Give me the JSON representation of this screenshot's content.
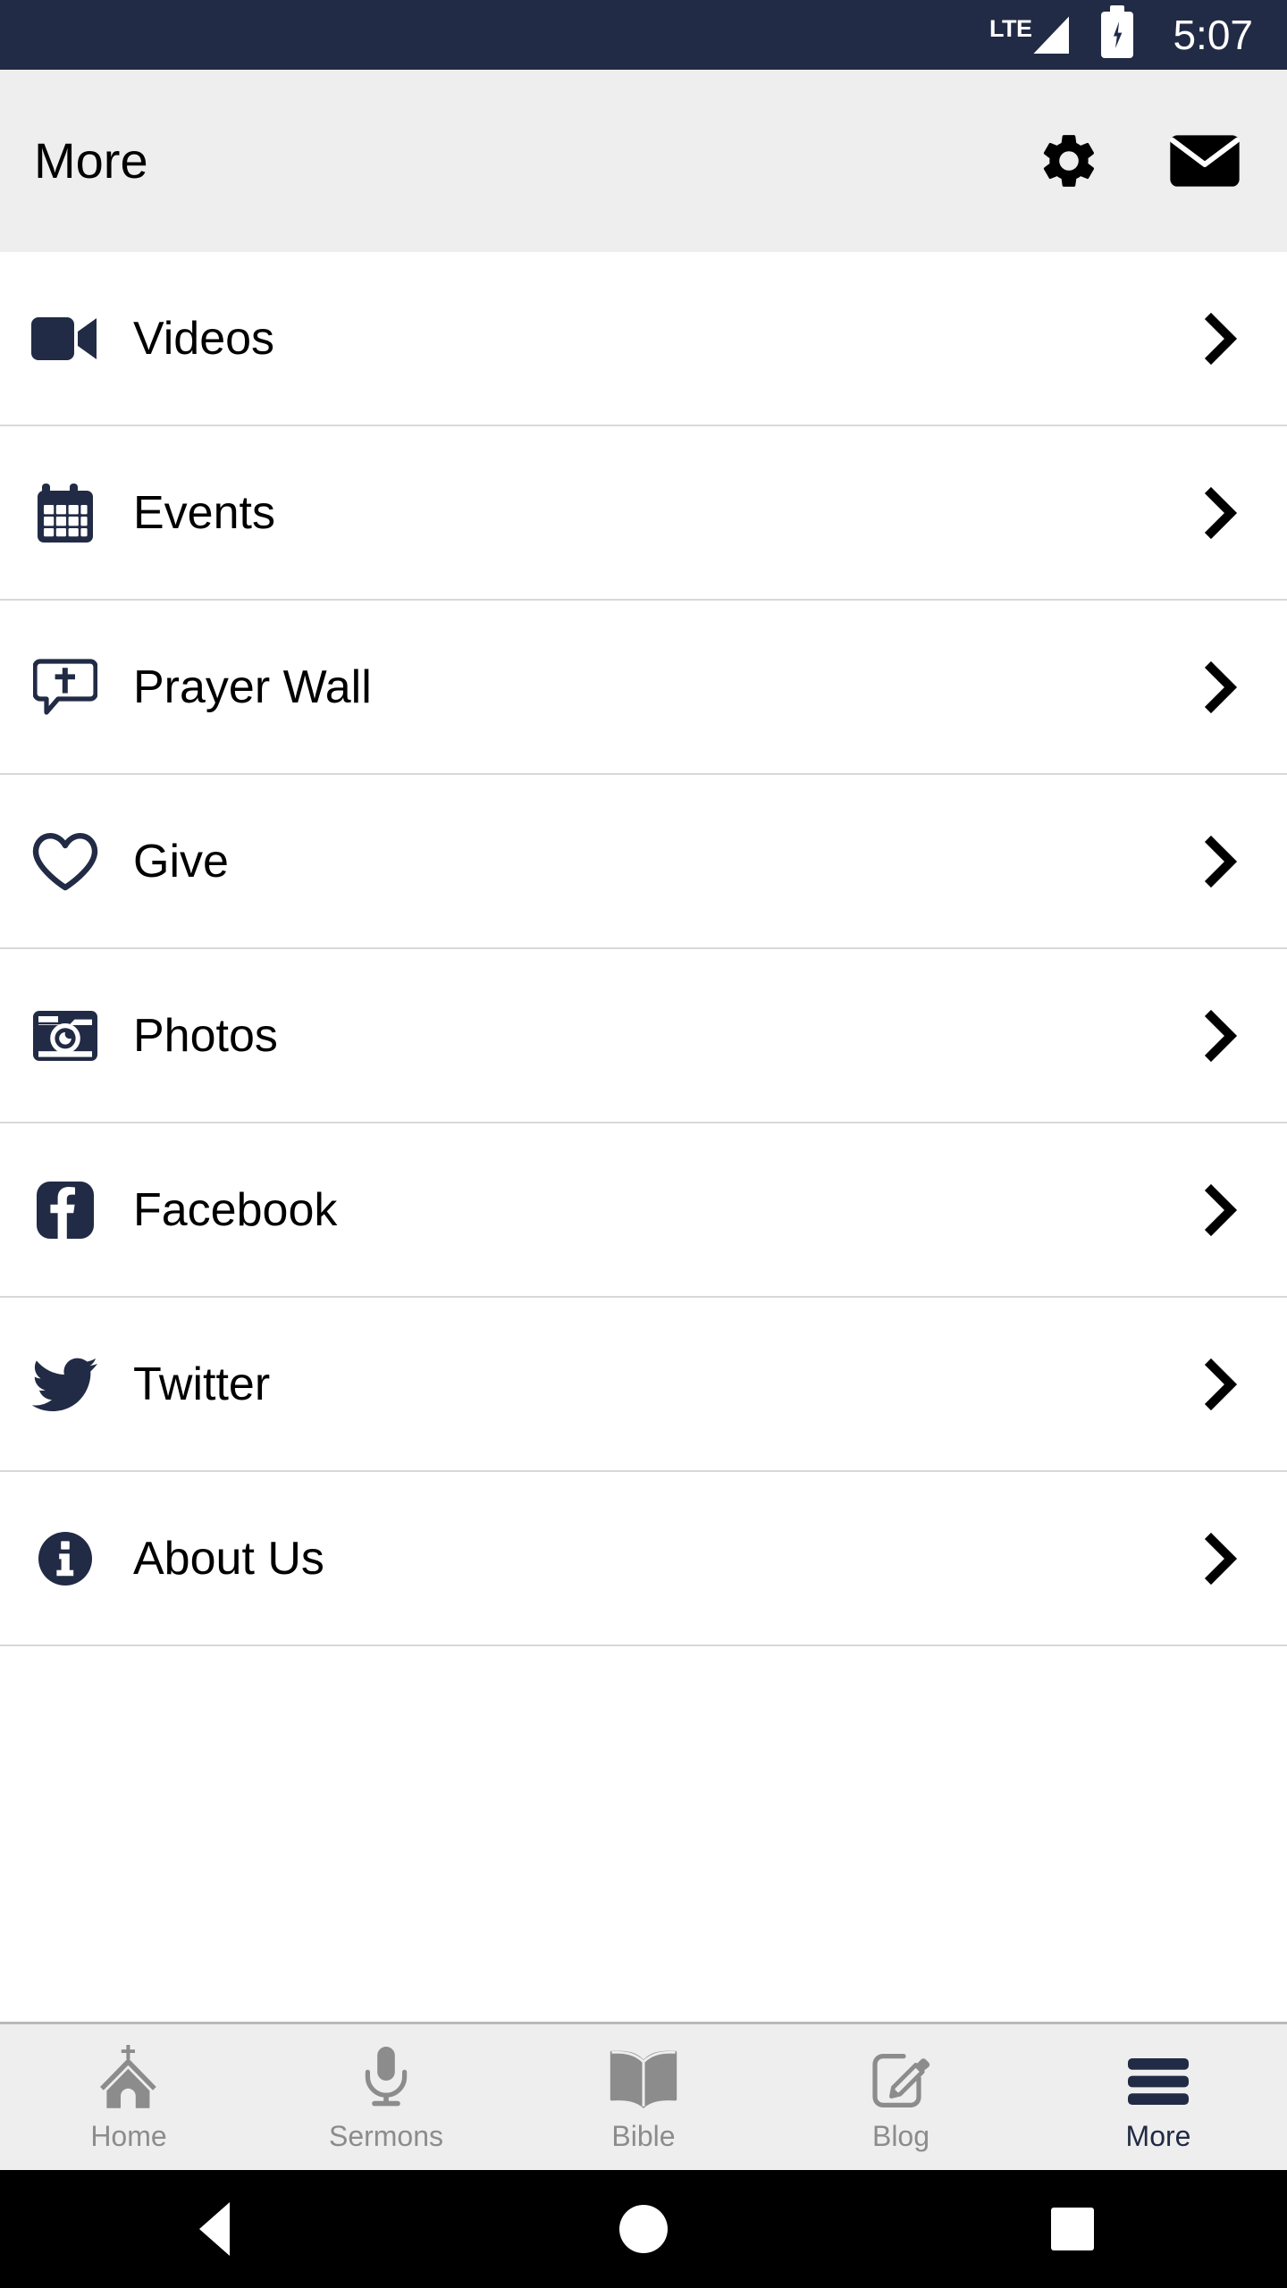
{
  "status_bar": {
    "network_label": "LTE",
    "signal_icon": "signal-triangle-icon",
    "battery_icon": "battery-charging-icon",
    "time": "5:07"
  },
  "header": {
    "title": "More",
    "actions": [
      {
        "name": "settings-button",
        "icon": "gear-icon"
      },
      {
        "name": "mail-button",
        "icon": "envelope-icon"
      }
    ]
  },
  "colors": {
    "navy": "#222b45",
    "header_bg": "#eeeeee",
    "divider": "#d8d8d8",
    "inactive_tab": "#8c8c8c",
    "status_bg": "#222b45"
  },
  "list": {
    "chevron_icon": "chevron-right-icon",
    "items": [
      {
        "label": "Videos",
        "icon": "video-camera-icon"
      },
      {
        "label": "Events",
        "icon": "calendar-icon"
      },
      {
        "label": "Prayer Wall",
        "icon": "prayer-chat-cross-icon"
      },
      {
        "label": "Give",
        "icon": "heart-outline-icon"
      },
      {
        "label": "Photos",
        "icon": "camera-icon"
      },
      {
        "label": "Facebook",
        "icon": "facebook-icon"
      },
      {
        "label": "Twitter",
        "icon": "twitter-bird-icon"
      },
      {
        "label": "About Us",
        "icon": "info-circle-icon"
      }
    ]
  },
  "tabbar": {
    "items": [
      {
        "label": "Home",
        "icon": "church-icon",
        "active": false
      },
      {
        "label": "Sermons",
        "icon": "microphone-icon",
        "active": false
      },
      {
        "label": "Bible",
        "icon": "open-book-icon",
        "active": false
      },
      {
        "label": "Blog",
        "icon": "pencil-square-icon",
        "active": false
      },
      {
        "label": "More",
        "icon": "hamburger-icon",
        "active": true
      }
    ]
  },
  "navbar": {
    "back": "back-triangle-icon",
    "home": "home-circle-icon",
    "recents": "recents-square-icon"
  }
}
